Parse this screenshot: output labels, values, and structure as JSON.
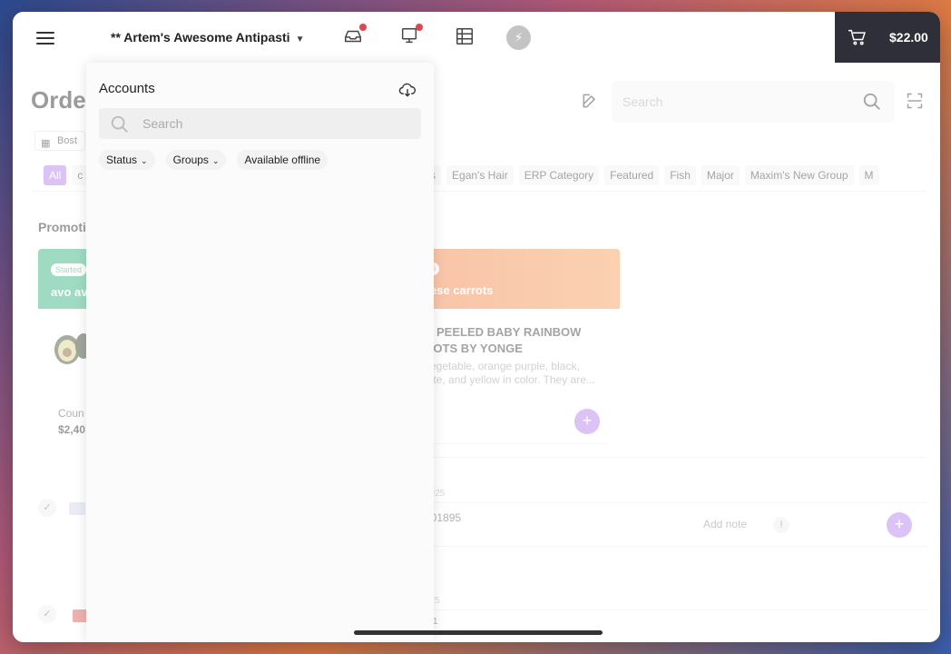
{
  "topbar": {
    "store_name": "** Artem's Awesome Antipasti",
    "cart_total": "$22.00"
  },
  "page": {
    "title": "Orde",
    "location_chip": "Bost",
    "search_placeholder": "Search",
    "filters": [
      "All",
      "c",
      "arrots",
      "Egan's Hair",
      "ERP Category",
      "Featured",
      "Fish",
      "Major",
      "Maxim's New Group",
      "M"
    ],
    "promotions_title": "Promoti",
    "promo_green": {
      "badge": "Started",
      "name": "avo av"
    },
    "promo_orange": {
      "pct": "%",
      "name": "ese carrots"
    },
    "product_title": "D PEELED BABY RAINBOW\nROTS BY YONGE",
    "product_desc": "vegetable, orange purple, black,\nhite, and yellow in color. They are...",
    "count_label": "Coun",
    "count_value": "$2,40",
    "order1": {
      "date": "2025",
      "id": "001895",
      "note": "Add note",
      "info": "!"
    },
    "order2": {
      "date": "025",
      "id": "7-1"
    }
  },
  "accounts": {
    "title": "Accounts",
    "search_placeholder": "Search",
    "filters": {
      "status": "Status",
      "groups": "Groups",
      "offline": "Available offline"
    }
  },
  "colors": {
    "accent": "#b07ce8",
    "promo_green": "#2ab07a",
    "promo_orange": "#f07a3c",
    "cart_bg": "#2f2f3a",
    "notification": "#e0474c"
  },
  "icons": [
    "hamburger-menu-icon",
    "inbox-icon",
    "display-icon",
    "table-icon",
    "bolt-icon",
    "cart-icon",
    "edit-icon",
    "search-icon",
    "scan-icon",
    "calendar-icon",
    "cloud-download-icon",
    "check-icon",
    "plus-icon"
  ]
}
